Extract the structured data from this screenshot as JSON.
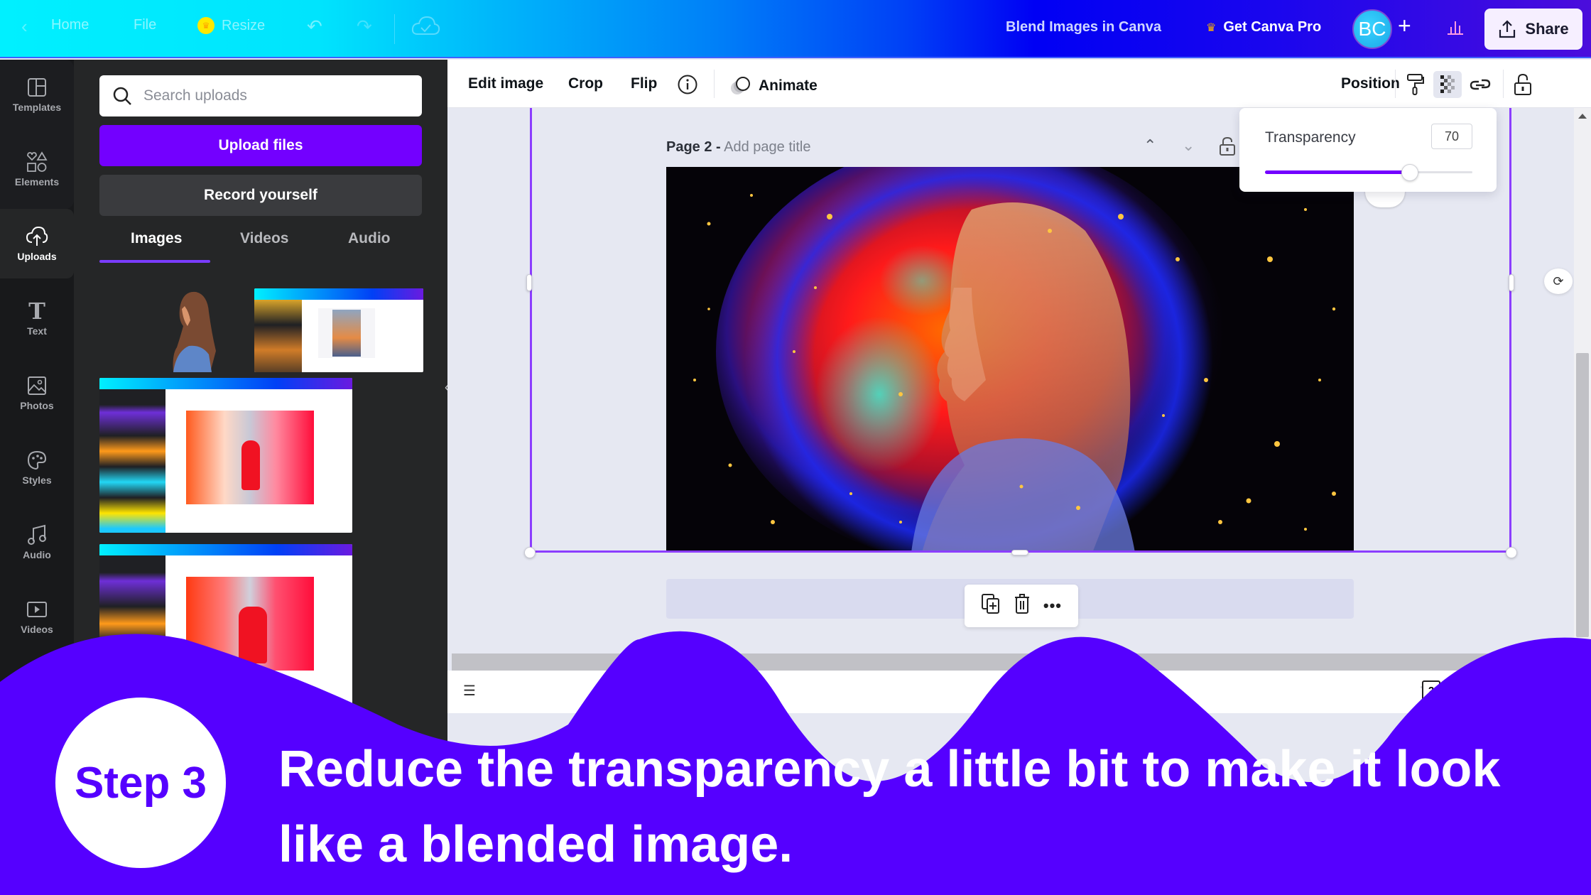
{
  "topbar": {
    "back_icon": "chevron-left-icon",
    "home": "Home",
    "file": "File",
    "resize": "Resize",
    "undo_icon": "undo-icon",
    "redo_icon": "redo-icon",
    "saved_icon": "cloud-check-icon",
    "doc_title": "Blend Images in Canva",
    "get_pro": "Get Canva Pro",
    "avatar_initials": "BC",
    "add_icon": "+",
    "share": "Share"
  },
  "rail": {
    "items": [
      {
        "label": "Templates",
        "icon": "templates-icon"
      },
      {
        "label": "Elements",
        "icon": "elements-icon"
      },
      {
        "label": "Uploads",
        "icon": "upload-cloud-icon",
        "active": true
      },
      {
        "label": "Text",
        "icon": "text-icon"
      },
      {
        "label": "Photos",
        "icon": "photos-icon"
      },
      {
        "label": "Styles",
        "icon": "palette-icon"
      },
      {
        "label": "Audio",
        "icon": "music-note-icon"
      },
      {
        "label": "Videos",
        "icon": "video-play-icon"
      }
    ]
  },
  "panel": {
    "search_placeholder": "Search uploads",
    "search_value": "",
    "upload_button": "Upload files",
    "record_button": "Record yourself",
    "tabs": [
      {
        "label": "Images",
        "active": true
      },
      {
        "label": "Videos"
      },
      {
        "label": "Audio"
      }
    ]
  },
  "context_toolbar": {
    "edit_image": "Edit image",
    "crop": "Crop",
    "flip": "Flip",
    "animate": "Animate",
    "position": "Position"
  },
  "canvas": {
    "page_number": "Page 2 -",
    "page_title_placeholder": "Add page title",
    "page_count": "2"
  },
  "transparency": {
    "label": "Transparency",
    "value": "70",
    "percent": 70
  },
  "banner": {
    "step": "Step 3",
    "text": "Reduce the transparency a little bit to make it look like a blended image."
  },
  "colors": {
    "accent": "#7300ff",
    "banner": "#5500ff",
    "selection": "#8b3dff"
  }
}
